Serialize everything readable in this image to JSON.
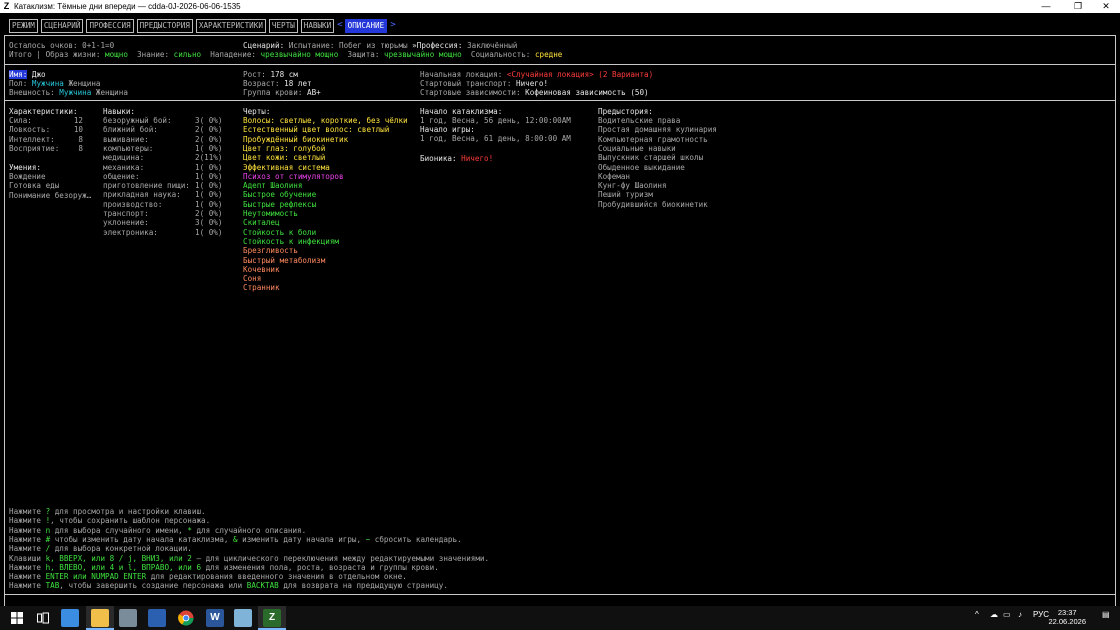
{
  "window": {
    "title": "Катаклизм: Тёмные дни впереди — cdda-0J-2026-06-06-1535",
    "app_icon": "Z",
    "min_icon": "—",
    "max_icon": "❐",
    "close_icon": "✕"
  },
  "tabs": [
    "РЕЖИМ",
    "СЦЕНАРИЙ",
    "ПРОФЕССИЯ",
    "ПРЕДЫСТОРИЯ",
    "ХАРАКТЕРИСТИКИ",
    "ЧЕРТЫ",
    "НАВЫКИ",
    "ОПИСАНИЕ"
  ],
  "active_tab_arrows": {
    "left": "<",
    "right": ">"
  },
  "summary": {
    "points_label": "Осталось очков:",
    "points_value": "0+1-1=0",
    "total_label": "Итого |",
    "lifestyle_label": "Образ жизни:",
    "lifestyle_value": "мощно",
    "knowledge_label": "Знание:",
    "knowledge_value": "сильно",
    "attack_label": "Нападение:",
    "attack_value": "чрезвычайно мощно",
    "defense_label": "Защита:",
    "defense_value": "чрезвычайно мощно",
    "social_label": "Социальность:",
    "social_value": "средне",
    "scenario_label": "Сценарий:",
    "scenario_value": "Испытание: Побег из тюрьмы",
    "profession_label": "Профессия:",
    "profession_value": "Заключённый"
  },
  "identity": {
    "name_label": "Имя:",
    "name_value": "Джо",
    "gender_label": "Пол:",
    "gender_male": "Мужчина",
    "gender_female": "Женщина",
    "appearance_label": "Внешность:",
    "appearance_male": "Мужчина",
    "appearance_female": "Женщина",
    "height_label": "Рост:",
    "height_value": "178 см",
    "age_label": "Возраст:",
    "age_value": "18 лет",
    "blood_label": "Группа крови:",
    "blood_value": "AB+",
    "location_label": "Начальная локация:",
    "location_value": "<Случайная локация> (2 Варианта)",
    "transport_label": "Стартовый транспорт:",
    "transport_value": "Ничего!",
    "addiction_label": "Стартовые зависимости:",
    "addiction_value": "Кофеиновая зависимость (50)"
  },
  "stats": {
    "header": "Характеристики:",
    "items": [
      {
        "label": "Сила:",
        "value": "12"
      },
      {
        "label": "Ловкость:",
        "value": "10"
      },
      {
        "label": "Интеллект:",
        "value": "8"
      },
      {
        "label": "Восприятие:",
        "value": "8"
      }
    ]
  },
  "proficiencies": {
    "header": "Умения:",
    "items": [
      "Вождение",
      "Готовка еды",
      "Понимание безоруж…"
    ]
  },
  "skills": {
    "header": "Навыки:",
    "items": [
      {
        "label": "безоружный бой:",
        "value": "3( 0%)"
      },
      {
        "label": "ближний бой:",
        "value": "2( 0%)"
      },
      {
        "label": "выживание:",
        "value": "2( 0%)"
      },
      {
        "label": "компьютеры:",
        "value": "1( 0%)"
      },
      {
        "label": "медицина:",
        "value": "2(11%)"
      },
      {
        "label": "механика:",
        "value": "1( 0%)"
      },
      {
        "label": "общение:",
        "value": "1( 0%)"
      },
      {
        "label": "приготовление пищи:",
        "value": "1( 0%)"
      },
      {
        "label": "прикладная наука:",
        "value": "1( 0%)"
      },
      {
        "label": "производство:",
        "value": "1( 0%)"
      },
      {
        "label": "транспорт:",
        "value": "2( 0%)"
      },
      {
        "label": "уклонение:",
        "value": "3( 0%)"
      },
      {
        "label": "электроника:",
        "value": "1( 0%)"
      }
    ]
  },
  "traits": {
    "header": "Черты:",
    "items": [
      {
        "text": "Волосы: светлые, короткие, без чёлки",
        "color": "#ffe33c"
      },
      {
        "text": "Естественный цвет волос: светлый",
        "color": "#ffe33c"
      },
      {
        "text": "Пробуждённый биокинетик",
        "color": "#ffe33c"
      },
      {
        "text": "Цвет глаз: голубой",
        "color": "#ffe33c"
      },
      {
        "text": "Цвет кожи: светлый",
        "color": "#ffe33c"
      },
      {
        "text": "Эффективная система",
        "color": "#ffe33c"
      },
      {
        "text": "Психоз от стимуляторов",
        "color": "#ee44ee"
      },
      {
        "text": "Адепт Шаолиня",
        "color": "#3fe23f"
      },
      {
        "text": "Быстрое обучение",
        "color": "#3fe23f"
      },
      {
        "text": "Быстрые рефлексы",
        "color": "#3fe23f"
      },
      {
        "text": "Неутомимость",
        "color": "#3fe23f"
      },
      {
        "text": "Скиталец",
        "color": "#3fe23f"
      },
      {
        "text": "Стойкость к боли",
        "color": "#3fe23f"
      },
      {
        "text": "Стойкость к инфекциям",
        "color": "#3fe23f"
      },
      {
        "text": "Брезгливость",
        "color": "#ff8a5e"
      },
      {
        "text": "Быстрый метаболизм",
        "color": "#ff8a5e"
      },
      {
        "text": "Кочевник",
        "color": "#ff8a5e"
      },
      {
        "text": "Соня",
        "color": "#ff8a5e"
      },
      {
        "text": "Странник",
        "color": "#ff8a5e"
      }
    ]
  },
  "time": {
    "cataclysm_label": "Начало катаклизма:",
    "cataclysm_value": "1 год, Весна, 56 день, 12:00:00AM",
    "game_label": "Начало игры:",
    "game_value": "1 год, Весна, 61 день, 8:00:00 AM",
    "bionics_label": "Бионика:",
    "bionics_value": "Ничего!"
  },
  "background": {
    "header": "Предыстория:",
    "items": [
      "Водительские права",
      "Простая домашняя кулинария",
      "Компьютерная грамотность",
      "Социальные навыки",
      "Выпускник старшей школы",
      "Обыденное выкидание",
      "Кофеман",
      "Кунг-фу Шаолиня",
      "Пеший туризм",
      "Пробудившийся биокинетик"
    ]
  },
  "help": [
    {
      "pre": "Нажмите ",
      "key": "?",
      "post": " для просмотра и настройки клавиш."
    },
    {
      "pre": "Нажмите ",
      "key": "!",
      "post": ", чтобы сохранить шаблон персонажа."
    },
    {
      "pre": "Нажмите ",
      "key": "n",
      "post": " для выбора случайного имени, ",
      "key2": "*",
      "post2": " для случайного описания."
    },
    {
      "pre": "Нажмите ",
      "key": "#",
      "post": " чтобы изменить дату начала катаклизма, ",
      "key2": "&",
      "post2": " изменить дату начала игры, ",
      "key3": "~",
      "post3": " сбросить календарь."
    },
    {
      "pre": "Нажмите ",
      "key": "/",
      "post": " для выбора конкретной локации."
    },
    {
      "pre": "Клавиши ",
      "key": "k, ВВЕРХ, или 8 / j, ВНИЗ, или 2",
      "post": " — для циклического переключения между редактируемыми значениями."
    },
    {
      "pre": "Нажмите ",
      "key": "h, ВЛЕВО, или 4 и l, ВПРАВО, или 6",
      "post": " для изменения пола, роста, возраста и группы крови."
    },
    {
      "pre": "Нажмите ",
      "key": "ENTER или NUMPAD ENTER",
      "post": " для редактирования введенного значения в отдельном окне."
    },
    {
      "pre": "Нажмите ",
      "key": "TAB",
      "post": ", чтобы завершить создание персонажа или ",
      "key2": "BACKTAB",
      "post2": " для возврата на предыдущую страницу."
    }
  ],
  "taskbar": {
    "icons": [
      "windows-start-icon",
      "task-view-icon",
      "file-explorer-icon",
      "folder-icon",
      "network-icon",
      "settings-icon",
      "chrome-icon",
      "word-icon",
      "notepad-icon",
      "cdda-icon"
    ],
    "tray_chevron": "^",
    "tray_lang": "РУС",
    "time": "23:37",
    "date": "22.06.2026"
  }
}
